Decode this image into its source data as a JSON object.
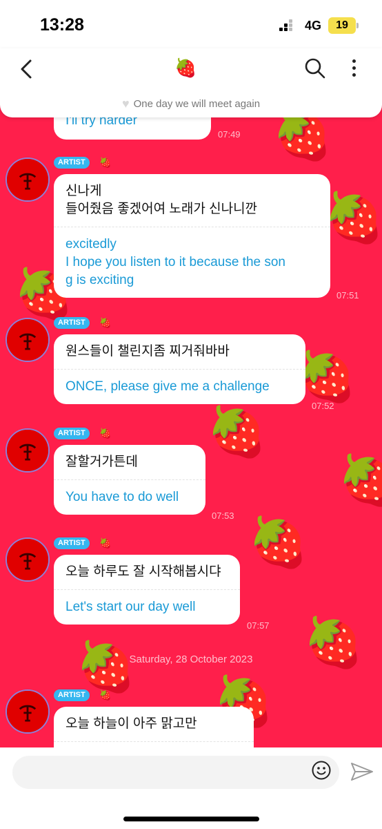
{
  "status_bar": {
    "time": "13:28",
    "network": "4G",
    "battery": "19"
  },
  "header": {
    "back_icon": "chevron-left-icon",
    "title_icon": "🍓",
    "search_icon": "search-icon",
    "more_icon": "more-vertical-icon",
    "notice": "One day we will meet again",
    "notice_icon": "heart-icon"
  },
  "chat": {
    "background_color": "#ff1f4b",
    "partial_top": {
      "text": "I'll try harder",
      "time": "07:49"
    },
    "messages": [
      {
        "badge": "ARTIST",
        "ko": [
          "신나게",
          "들어줬음 좋겠어여 노래가 신나니깐"
        ],
        "en": [
          "excitedly",
          "I hope you listen to it because the son",
          "g is exciting"
        ],
        "time": "07:51"
      },
      {
        "badge": "ARTIST",
        "ko": [
          "원스들이 챌린지좀 찌거줘바바"
        ],
        "en": [
          "ONCE, please give me a challenge"
        ],
        "time": "07:52"
      },
      {
        "badge": "ARTIST",
        "ko": [
          "잘할거가튼데"
        ],
        "en": [
          "You have to do well"
        ],
        "time": "07:53"
      },
      {
        "badge": "ARTIST",
        "ko": [
          "오늘 하루도 잘 시작해봅시댜"
        ],
        "en": [
          "Let's start our day well"
        ],
        "time": "07:57"
      }
    ],
    "date_separator": "Saturday, 28 October 2023",
    "last_message": {
      "badge": "ARTIST",
      "ko": "오늘 하늘이 아주 맑고만"
    }
  },
  "input": {
    "emoji_icon": "smiley-icon",
    "send_icon": "send-icon"
  },
  "colors": {
    "accent": "#1a9ad6",
    "badge": "#35b6ef",
    "chat_bg": "#ff1f4b"
  }
}
